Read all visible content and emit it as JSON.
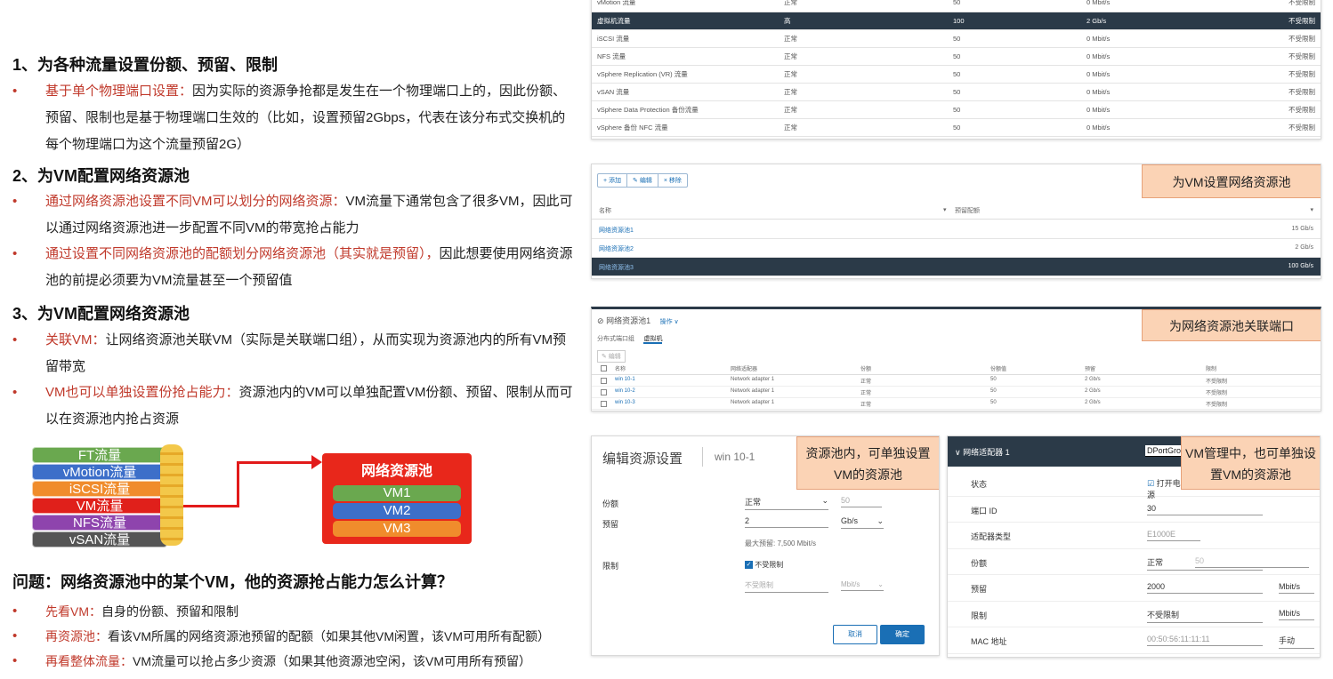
{
  "left": {
    "h1": "1、为各种流量设置份额、预留、限制",
    "b1_red": "基于单个物理端口设置：",
    "b1_text": "因为实际的资源争抢都是发生在一个物理端口上的，因此份额、预留、限制也是基于物理端口生效的（比如，设置预留2Gbps，代表在该分布式交换机的每个物理端口为这个流量预留2G）",
    "h2": "2、为VM配置网络资源池",
    "b2_red": "通过网络资源池设置不同VM可以划分的网络资源：",
    "b2_text": "VM流量下通常包含了很多VM，因此可以通过网络资源池进一步配置不同VM的带宽抢占能力",
    "b3_red": "通过设置不同网络资源池的配额划分网络资源池（其实就是预留），",
    "b3_text": "因此想要使用网络资源池的前提必须要为VM流量甚至一个预留值",
    "h3": "3、为VM配置网络资源池",
    "b4_red": "关联VM：",
    "b4_text": "让网络资源池关联VM（实际是关联端口组），从而实现为资源池内的所有VM预留带宽",
    "b5_red": "VM也可以单独设置份抢占能力：",
    "b5_text": "资源池内的VM可以单独配置VM份额、预留、限制从而可以在资源池内抢占资源",
    "question": "问题：网络资源池中的某个VM，他的资源抢占能力怎么计算？",
    "q1_red": "先看VM：",
    "q1_text": "自身的份额、预留和限制",
    "q2_red": "再资源池：",
    "q2_text": "看该VM所属的网络资源池预留的配额（如果其他VM闲置，该VM可用所有配额）",
    "q3_red": "再看整体流量：",
    "q3_text": "VM流量可以抢占多少资源（如果其他资源池空闲，该VM可用所有预留）"
  },
  "diagram": {
    "flows": [
      {
        "label": "FT流量",
        "color": "#6aa84f"
      },
      {
        "label": "vMotion流量",
        "color": "#3d6fc9"
      },
      {
        "label": "iSCSI流量",
        "color": "#f08c2c"
      },
      {
        "label": "VM流量",
        "color": "#e0201b"
      },
      {
        "label": "NFS流量",
        "color": "#8e44ad"
      },
      {
        "label": "vSAN流量",
        "color": "#555555"
      }
    ],
    "pool_title": "网络资源池",
    "vms": [
      {
        "label": "VM1",
        "color": "#6aa84f"
      },
      {
        "label": "VM2",
        "color": "#3d6fc9"
      },
      {
        "label": "VM3",
        "color": "#f08c2c"
      }
    ]
  },
  "traffic_table": {
    "rows": [
      {
        "name": "vMotion 流量",
        "shares": "正常",
        "value": "50",
        "reserve": "0 Mbit/s",
        "limit": "不受限制"
      },
      {
        "name": "虚拟机流量",
        "shares": "高",
        "value": "100",
        "reserve": "2 Gb/s",
        "limit": "不受限制",
        "selected": true
      },
      {
        "name": "iSCSI 流量",
        "shares": "正常",
        "value": "50",
        "reserve": "0 Mbit/s",
        "limit": "不受限制"
      },
      {
        "name": "NFS 流量",
        "shares": "正常",
        "value": "50",
        "reserve": "0 Mbit/s",
        "limit": "不受限制"
      },
      {
        "name": "vSphere Replication (VR) 流量",
        "shares": "正常",
        "value": "50",
        "reserve": "0 Mbit/s",
        "limit": "不受限制"
      },
      {
        "name": "vSAN 流量",
        "shares": "正常",
        "value": "50",
        "reserve": "0 Mbit/s",
        "limit": "不受限制"
      },
      {
        "name": "vSphere Data Protection 备份流量",
        "shares": "正常",
        "value": "50",
        "reserve": "0 Mbit/s",
        "limit": "不受限制"
      },
      {
        "name": "vSphere 备份 NFC 流量",
        "shares": "正常",
        "value": "50",
        "reserve": "0 Mbit/s",
        "limit": "不受限制"
      }
    ]
  },
  "pool_panel": {
    "tag": "为VM设置网络资源池",
    "btn_add": "+ 添加",
    "btn_edit": "✎ 编辑",
    "btn_remove": "× 移除",
    "col_name": "名称",
    "col_reserve": "预留配额",
    "rows": [
      {
        "name": "网络资源池1",
        "value": "15 Gb/s"
      },
      {
        "name": "网络资源池2",
        "value": "2 Gb/s"
      },
      {
        "name": "网络资源池3",
        "value": "100 Gb/s",
        "selected": true
      }
    ]
  },
  "assoc_panel": {
    "tag": "为网络资源池关联端口",
    "title": "网络资源池1",
    "actions": "操作 ∨",
    "tab1": "分布式端口组",
    "tab2": "虚拟机",
    "edit": "✎ 编辑",
    "cols": [
      "名称",
      "网络适配器",
      "份额",
      "份额值",
      "预留",
      "限制"
    ],
    "rows": [
      {
        "name": "win 10-1",
        "adapter": "Network adapter 1",
        "shares": "正常",
        "value": "50",
        "reserve": "2 Gb/s",
        "limit": "不受限制"
      },
      {
        "name": "win 10-2",
        "adapter": "Network adapter 1",
        "shares": "正常",
        "value": "50",
        "reserve": "2 Gb/s",
        "limit": "不受限制"
      },
      {
        "name": "win 10-3",
        "adapter": "Network adapter 1",
        "shares": "正常",
        "value": "50",
        "reserve": "2 Gb/s",
        "limit": "不受限制"
      }
    ]
  },
  "edit_panel": {
    "title": "编辑资源设置",
    "subtitle": "win 10-1",
    "tag": "资源池内，可单独设置VM的资源池",
    "shares_label": "份额",
    "shares_value": "正常",
    "shares_num": "50",
    "reserve_label": "预留",
    "reserve_value": "2",
    "reserve_unit": "Gb/s",
    "max_reserve": "最大预留: 7,500 Mbit/s",
    "limit_label": "限制",
    "limit_check": "不受限制",
    "limit_value": "不受限制",
    "limit_unit": "Mbit/s",
    "cancel": "取消",
    "ok": "确定"
  },
  "adapter_panel": {
    "title": "网络适配器 1",
    "portgroup": "DPortGro",
    "tag": "VM管理中，也可单独设置VM的资源池",
    "rows": [
      {
        "label": "状态",
        "value": "打开电源"
      },
      {
        "label": "端口 ID",
        "value": "30"
      },
      {
        "label": "适配器类型",
        "value": "E1000E"
      },
      {
        "label": "份额",
        "value": "正常",
        "extra": "50"
      },
      {
        "label": "预留",
        "value": "2000",
        "extra": "Mbit/s"
      },
      {
        "label": "限制",
        "value": "不受限制",
        "extra": "Mbit/s"
      },
      {
        "label": "MAC 地址",
        "value": "00:50:56:11:11:11",
        "extra": "手动"
      }
    ]
  }
}
